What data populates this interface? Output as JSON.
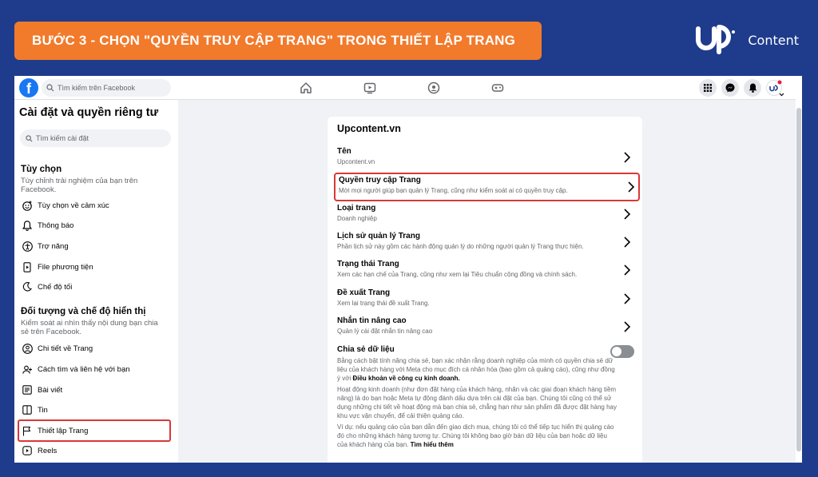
{
  "banner": {
    "title": "BƯỚC 3 - CHỌN \"QUYỀN TRUY CẬP TRANG\" TRONG THIẾT LẬP TRANG"
  },
  "brand": {
    "name": "Content"
  },
  "topbar": {
    "search_placeholder": "Tìm kiếm trên Facebook"
  },
  "sidebar": {
    "title": "Cài đặt và quyền riêng tư",
    "search_placeholder": "Tìm kiếm cài đặt",
    "section1": {
      "title": "Tùy chọn",
      "desc": "Tùy chỉnh trải nghiệm của bạn trên Facebook.",
      "items": [
        {
          "label": "Tùy chọn về cảm xúc",
          "icon": "emoji-icon"
        },
        {
          "label": "Thông báo",
          "icon": "bell-icon"
        },
        {
          "label": "Trợ năng",
          "icon": "accessibility-icon"
        },
        {
          "label": "File phương tiện",
          "icon": "media-file-icon"
        },
        {
          "label": "Chế độ tối",
          "icon": "moon-icon"
        }
      ]
    },
    "section2": {
      "title": "Đối tượng và chế độ hiển thị",
      "desc": "Kiểm soát ai nhìn thấy nội dung bạn chia sẻ trên Facebook.",
      "items": [
        {
          "label": "Chi tiết về Trang",
          "icon": "profile-icon"
        },
        {
          "label": "Cách tìm và liên hệ với bạn",
          "icon": "find-contact-icon"
        },
        {
          "label": "Bài viết",
          "icon": "posts-icon"
        },
        {
          "label": "Tin",
          "icon": "stories-icon"
        },
        {
          "label": "Thiết lập Trang",
          "icon": "flag-icon"
        },
        {
          "label": "Reels",
          "icon": "reels-icon"
        }
      ]
    }
  },
  "card": {
    "title": "Upcontent.vn",
    "rows": [
      {
        "title": "Tên",
        "desc": "Upcontent.vn"
      },
      {
        "title": "Quyền truy cập Trang",
        "desc": "Mời mọi người giúp bạn quản lý Trang, cũng như kiểm soát ai có quyền truy cập."
      },
      {
        "title": "Loại trang",
        "desc": "Doanh nghiệp"
      },
      {
        "title": "Lịch sử quản lý Trang",
        "desc": "Phần lịch sử này gồm các hành động quản lý do những người quản lý Trang thực hiện."
      },
      {
        "title": "Trạng thái Trang",
        "desc": "Xem các hạn chế của Trang, cũng như xem lại Tiêu chuẩn cộng đồng và chính sách."
      },
      {
        "title": "Đề xuất Trang",
        "desc": "Xem lại trạng thái đề xuất Trang."
      },
      {
        "title": "Nhắn tin nâng cao",
        "desc": "Quản lý cài đặt nhắn tin nâng cao"
      }
    ],
    "share": {
      "title": "Chia sẻ dữ liệu",
      "p1_a": "Bằng cách bật tính năng chia sẻ, bạn xác nhận rằng doanh nghiệp của mình có quyền chia sẻ dữ liệu của khách hàng với Meta cho mục đích cá nhân hóa (bao gồm cả quảng cáo), cũng như đồng ý với ",
      "p1_link": "Điều khoản về công cụ kinh doanh.",
      "p2": "Hoạt động kinh doanh (như đơn đặt hàng của khách hàng, nhãn và các giai đoạn khách hàng tiềm năng) là do bạn hoặc Meta tự động đánh dấu dựa trên cài đặt của bạn. Chúng tôi cũng có thể sử dụng những chi tiết về hoạt động mà bạn chia sẻ, chẳng hạn như sản phẩm đã được đặt hàng hay khu vực vận chuyển, để cải thiện quảng cáo.",
      "p3_a": "Ví dụ: nếu quảng cáo của bạn dẫn đến giao dịch mua, chúng tôi có thể tiếp tục hiển thị quảng cáo đó cho những khách hàng tương tự. Chúng tôi không bao giờ bán dữ liệu của bạn hoặc dữ liệu của khách hàng của bạn. ",
      "p3_link": "Tìm hiểu thêm"
    }
  },
  "colors": {
    "highlight": "#d93838",
    "banner": "#f27a2b",
    "background": "#1f3c8c",
    "facebook_blue": "#1877f2"
  }
}
